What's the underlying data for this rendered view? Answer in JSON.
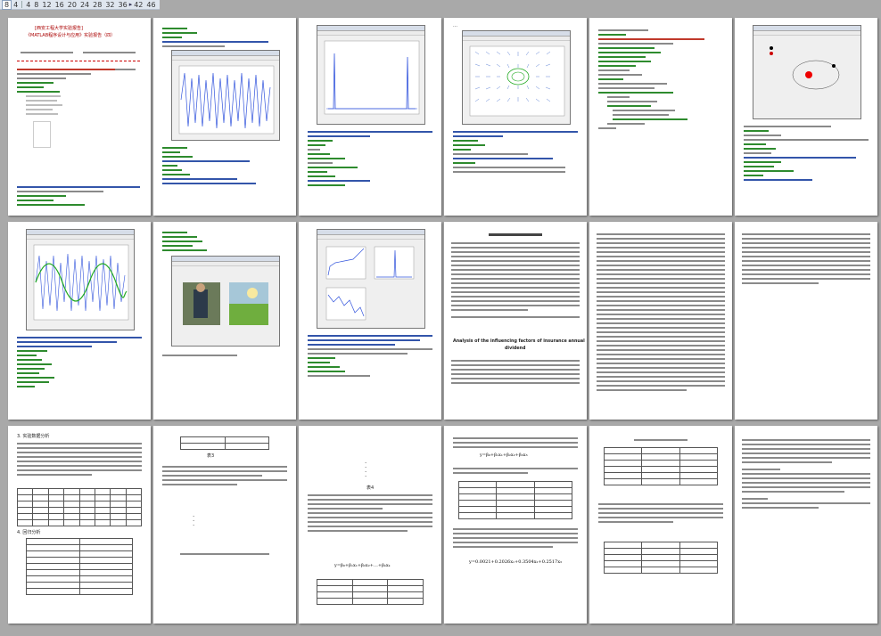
{
  "zoom": {
    "options": [
      "8",
      "4",
      "4",
      "8",
      "12",
      "16",
      "20",
      "24",
      "28",
      "32",
      "36",
      "42",
      "46"
    ],
    "selected_index": 0
  },
  "pages": {
    "p1_header_line1": "[西安工程大学实验报告]",
    "p1_header_line2": "《MATLAB程序设计与应用》实验报告（四）",
    "p12_title": "Analysis of the influencing factors of insurance annual",
    "p12_title2": "dividend",
    "p15_section": "3. 实验数据分析",
    "p15_section2": "4. 回归分析",
    "p16_caption": "表3",
    "p17_caption": "表4",
    "p18_eq": "y=β₀+β₁x₁+β₂x₂+…+βₖxₖ",
    "p19_eq": "y=β₀+β₁x₁+β₂x₂+β₃x₃",
    "p20_eq": "y=0.0021+0.2026x₁+0.3504x₂+0.2517x₃"
  },
  "colors": {
    "background": "#a9a9a9",
    "page": "#ffffff",
    "code_green": "#2e8b2e",
    "code_red": "#c0392b",
    "plot_blue": "#3355dd",
    "plot_green": "#22aa22"
  }
}
